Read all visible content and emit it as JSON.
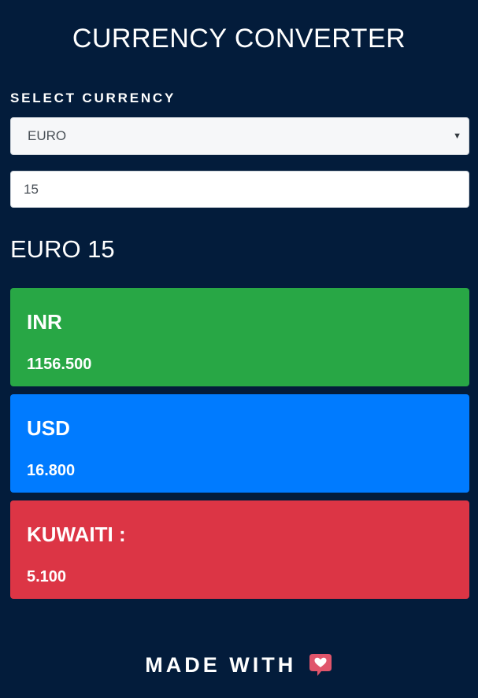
{
  "header": {
    "title": "CURRENCY CONVERTER"
  },
  "form": {
    "select_label": "SELECT CURRENCY",
    "selected_currency": "EURO",
    "amount_value": "15"
  },
  "result": {
    "heading": "EURO 15"
  },
  "conversions": [
    {
      "code": "INR",
      "value": "1156.500",
      "color": "#28a745"
    },
    {
      "code": "USD",
      "value": "16.800",
      "color": "#007bff"
    },
    {
      "code": "KUWAITI :",
      "value": "5.100",
      "color": "#dc3545"
    }
  ],
  "footer": {
    "text": "MADE WITH",
    "icon": "heart-message-icon"
  },
  "colors": {
    "background": "#031c3b",
    "heart": "#e0556b"
  }
}
